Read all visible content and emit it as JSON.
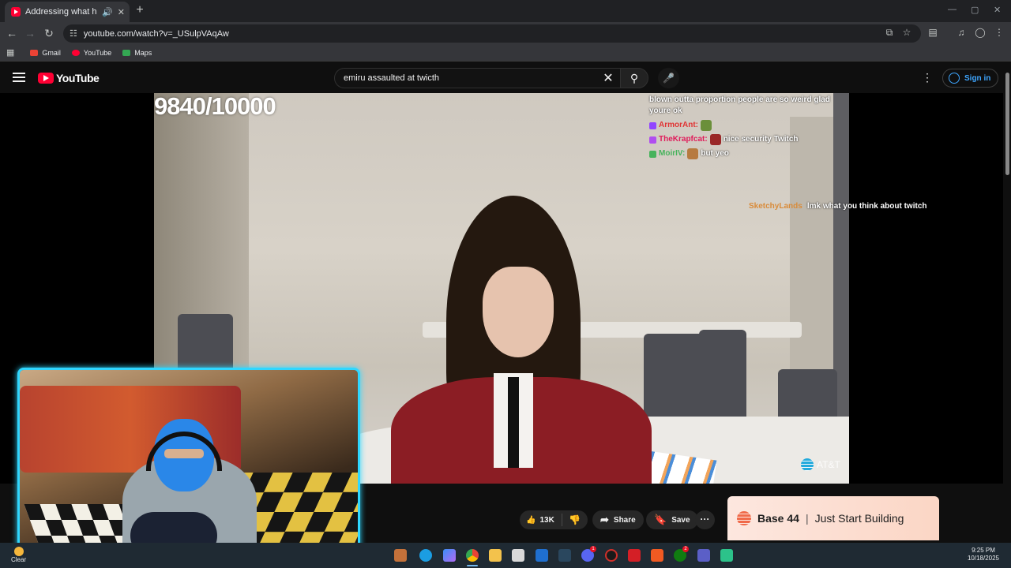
{
  "browser": {
    "tab_title": "Addressing what happened",
    "url": "youtube.com/watch?v=_USulpVAqAw",
    "bookmarks": [
      {
        "label": "Gmail",
        "color": "#ea4335"
      },
      {
        "label": "YouTube",
        "color": "#ff0033"
      },
      {
        "label": "Maps",
        "color": "#34a853"
      }
    ]
  },
  "youtube": {
    "logo_text": "YouTube",
    "search_query": "emiru assaulted at twicth",
    "sign_in_label": "Sign in"
  },
  "video": {
    "score_overlay": "9840/10000",
    "chat_top": "blown outta proportion people are so weird glad youre ok",
    "chat_lines": [
      {
        "user": "ArmorAnt:",
        "text": ""
      },
      {
        "user": "TheKrapfcat:",
        "text": "nice security Twitch"
      },
      {
        "user": "MoirIV:",
        "text": "but yeo"
      }
    ],
    "side_chat": {
      "user": "SketchyLands",
      "text": "lmk what you think about twitch"
    },
    "watermark": "AT&T"
  },
  "actions": {
    "likes": "13K",
    "share_label": "Share",
    "save_label": "Save"
  },
  "ad": {
    "brand": "Base 44",
    "separator": "|",
    "slogan": "Just Start Building"
  },
  "taskbar": {
    "weather_label": "Clear",
    "time": "9:25 PM",
    "date": "10/18/2025",
    "discord_badge": "1",
    "teams_badge": "2"
  },
  "colors": {
    "youtube_red": "#ff0033",
    "link_blue": "#3ea6ff",
    "webcam_border": "#2fd7ff"
  }
}
